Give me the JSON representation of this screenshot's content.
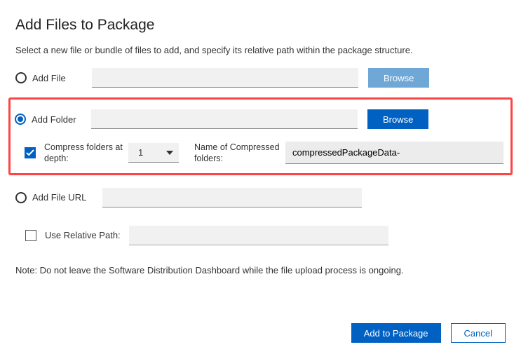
{
  "title": "Add Files to Package",
  "subtitle": "Select a new file or bundle of files to add, and specify its relative path within the package structure.",
  "options": {
    "addFile": {
      "label": "Add File",
      "value": "",
      "browse": "Browse"
    },
    "addFolder": {
      "label": "Add Folder",
      "value": "",
      "browse": "Browse"
    },
    "addFileUrl": {
      "label": "Add File URL",
      "value": ""
    }
  },
  "compress": {
    "label": "Compress folders at depth:",
    "depth": "1",
    "nameLabel": "Name of Compressed folders:",
    "nameValue": "compressedPackageData-"
  },
  "useRelative": {
    "label": "Use Relative Path:",
    "value": ""
  },
  "note": "Note: Do not leave the Software Distribution Dashboard while the file upload process is ongoing.",
  "buttons": {
    "addToPackage": "Add to Package",
    "cancel": "Cancel"
  }
}
